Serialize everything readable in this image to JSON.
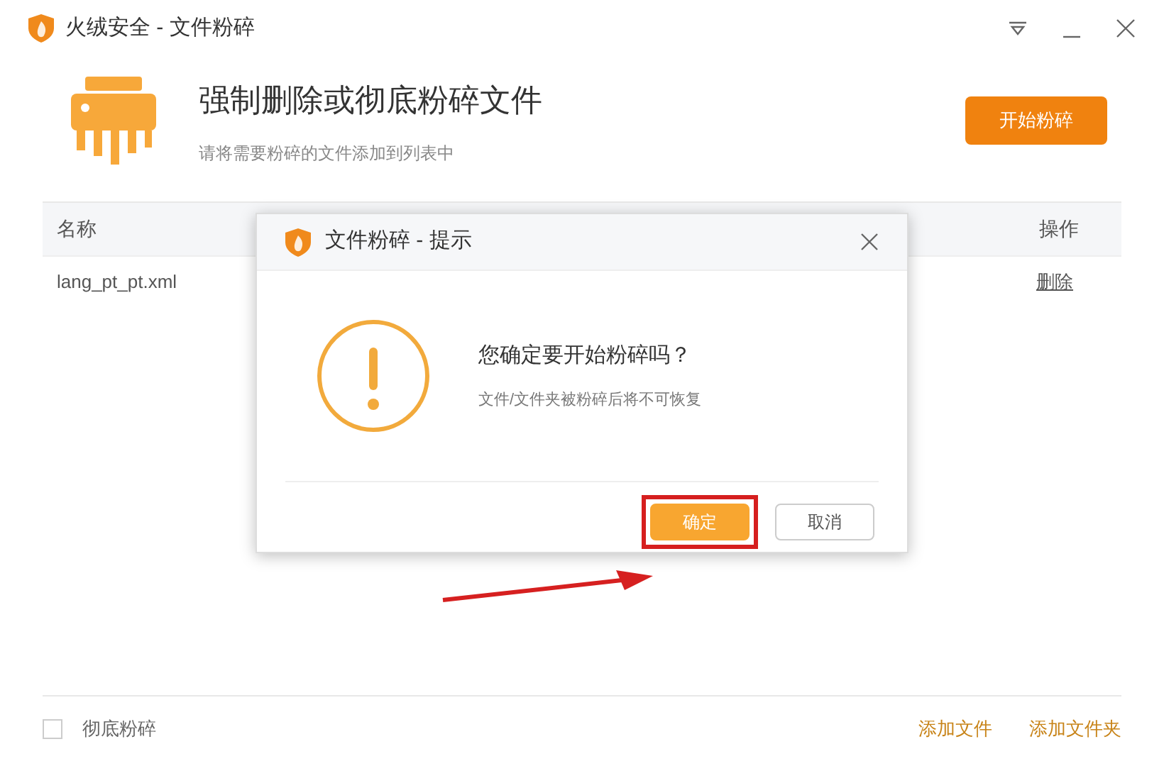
{
  "window": {
    "title": "火绒安全 - 文件粉碎"
  },
  "header": {
    "title": "强制删除或彻底粉碎文件",
    "subtitle": "请将需要粉碎的文件添加到列表中",
    "start_button": "开始粉碎"
  },
  "table": {
    "columns": [
      "名称",
      "操作"
    ],
    "rows": [
      {
        "name": "lang_pt_pt.xml",
        "action": "删除"
      }
    ]
  },
  "footer": {
    "checkbox": {
      "label": "彻底粉碎",
      "checked": false
    },
    "links": [
      "添加文件",
      "添加文件夹"
    ]
  },
  "dialog": {
    "title": "文件粉碎 - 提示",
    "question": "您确定要开始粉碎吗？",
    "note": "文件/文件夹被粉碎后将不可恢复",
    "buttons": [
      {
        "label": "确定",
        "kind": "primary",
        "highlighted": true
      },
      {
        "label": "取消",
        "kind": "secondary",
        "highlighted": false
      }
    ]
  }
}
